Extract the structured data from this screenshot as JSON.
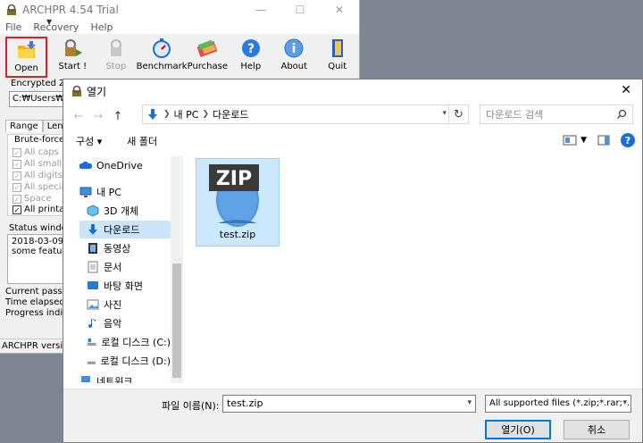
{
  "archpr": {
    "title": "ARCHPR 4.54 Trial",
    "window_controls": {
      "minimize": "—",
      "maximize": "☐",
      "close": "✕"
    },
    "menu": [
      "File",
      "Recovery",
      "Help"
    ],
    "toolbar": {
      "open": "Open",
      "start": "Start !",
      "stop": "Stop",
      "benchmark": "Benchmark",
      "purchase": "Purchase",
      "help": "Help",
      "about": "About",
      "quit": "Quit"
    },
    "encrypted_label": "Encrypted ZIP",
    "path_value": "C:₩Users₩",
    "tabs": [
      "Range",
      "Leng"
    ],
    "bruteforce_label": "Brute-force r",
    "checkboxes": [
      {
        "label": "All caps la",
        "enabled": false
      },
      {
        "label": "All small la",
        "enabled": false
      },
      {
        "label": "All digits (",
        "enabled": false
      },
      {
        "label": "All special",
        "enabled": false
      },
      {
        "label": "Space",
        "enabled": false
      },
      {
        "label": "All printab",
        "enabled": true
      }
    ],
    "status_window_label": "Status windo",
    "status_lines": [
      "2018-03-09 ",
      "some feature"
    ],
    "bottom_labels": [
      "Current passwo",
      "Time elapsed:",
      "Progress indicat"
    ],
    "statusbar": "ARCHPR version"
  },
  "dialog": {
    "title": "열기",
    "close": "✕",
    "nav": {
      "back": "←",
      "forward": "→",
      "up": "↑"
    },
    "breadcrumb": [
      "내 PC",
      "다운로드"
    ],
    "search_placeholder": "다운로드 검색",
    "organize": "구성 ▾",
    "new_folder": "새 폴더",
    "nav_items": [
      {
        "label": "OneDrive"
      },
      {
        "label": "내 PC"
      },
      {
        "label": "3D 개체"
      },
      {
        "label": "다운로드",
        "selected": true
      },
      {
        "label": "동영상"
      },
      {
        "label": "문서"
      },
      {
        "label": "바탕 화면"
      },
      {
        "label": "사진"
      },
      {
        "label": "음악"
      },
      {
        "label": "로컬 디스크 (C:)"
      },
      {
        "label": "로컬 디스크 (D:)"
      },
      {
        "label": "네트워크"
      }
    ],
    "file": {
      "name": "test.zip",
      "icon_text": "ZIP"
    },
    "filename_label": "파일 이름(N):",
    "filename_value": "test.zip",
    "filetype": "All supported files (*.zip;*.rar;*.",
    "open_button": "열기(O)",
    "cancel_button": "취소"
  }
}
